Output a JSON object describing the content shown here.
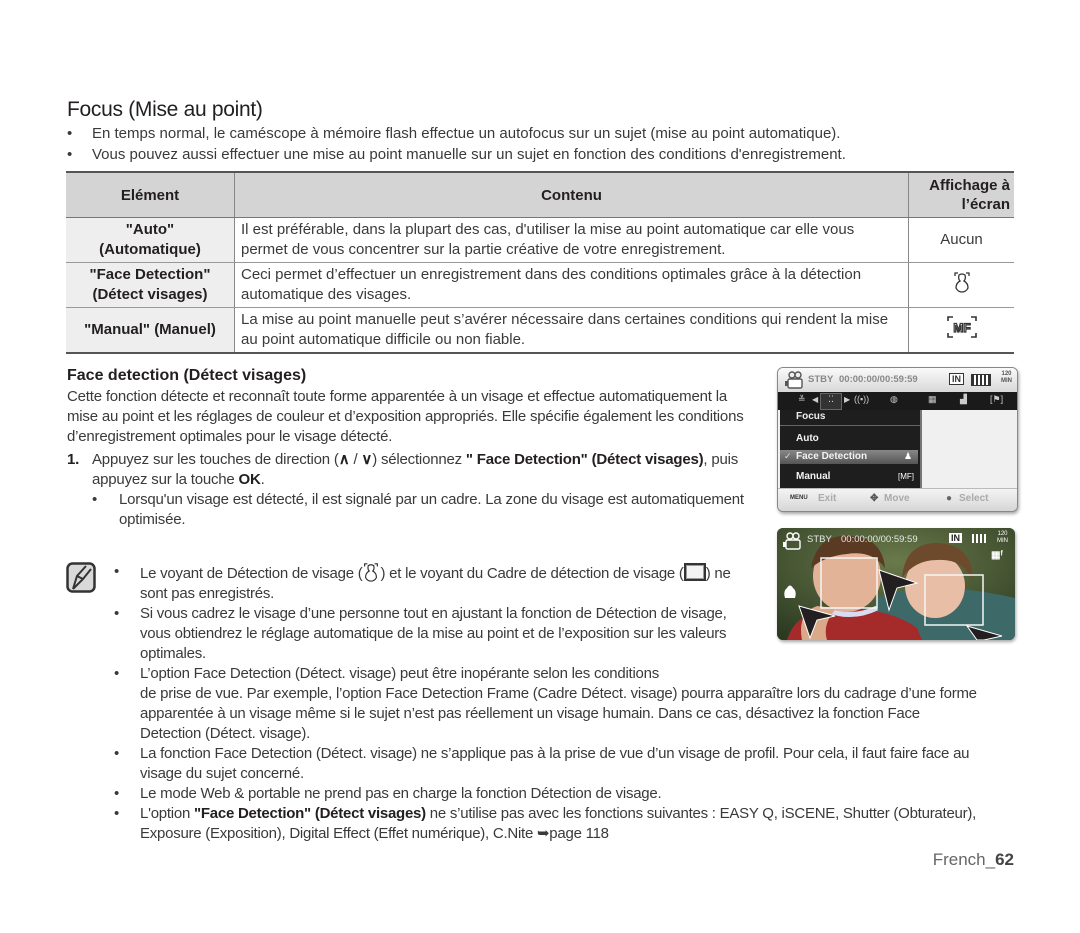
{
  "page": {
    "title": "Focus (Mise au point)",
    "intro_bullets": [
      "En temps normal, le caméscope à mémoire flash effectue un autofocus sur un sujet (mise au point automatique).",
      "Vous pouvez aussi effectuer une mise au point manuelle sur un sujet en fonction des conditions d'enregistrement."
    ],
    "bullet_char": "•"
  },
  "table": {
    "headers": [
      "Elément",
      "Contenu",
      "Affichage à",
      "l’écran"
    ],
    "rows": [
      {
        "element_line1": "\"Auto\"",
        "element_line2": "(Automatique)",
        "content": "Il est préférable, dans la plupart des cas, d'utiliser la mise au point automatique car elle vous permet de vous concentrer sur la partie créative de votre enregistrement.",
        "display": "Aucun",
        "display_icon": ""
      },
      {
        "element_line1": "\"Face Detection\"",
        "element_line2": "(Détect visages)",
        "content": "Ceci permet d’effectuer un enregistrement dans des conditions optimales grâce à la détection automatique des visages.",
        "display": "",
        "display_icon": "face-detection-icon"
      },
      {
        "element_line1": "\"Manual\" (Manuel)",
        "element_line2": "",
        "content": "La mise au point manuelle peut s’avérer nécessaire dans certaines conditions qui rendent la mise au point automatique difficile ou non fiable.",
        "display": "",
        "display_icon": "manual-focus-icon"
      }
    ]
  },
  "face_section": {
    "heading": "Face detection (Détect visages)",
    "description": "Cette fonction détecte et reconnaît toute forme apparentée à un visage et effectue automatiquement la mise au point et les réglages de couleur et d’exposition appropriés. Elle spécifie également les conditions d’enregistrement optimales pour le visage détecté.",
    "step": {
      "number": "1.",
      "text_a": "Appuyez sur les touches de direction (",
      "up_glyph": "∧",
      "slash": " / ",
      "down_glyph": "∨",
      "text_b": ") sélectionnez ",
      "bold_a": "\" Face Detection\" (Détect visages)",
      "text_c": ", puis appuyez sur la touche ",
      "bold_b": "OK",
      "text_d": "."
    },
    "sub_bullet": "Lorsqu'un visage est détecté, il est signalé par un cadre. La zone du visage est automatiquement optimisée."
  },
  "notes": {
    "icon": "note-pencil-icon",
    "items": [
      {
        "a": "Le voyant de Détection de visage (",
        "b": ") et le voyant du Cadre de détection de visage (",
        "c": ") ne sont pas enregistrés."
      },
      {
        "text": "Si vous cadrez le visage d’une personne tout en ajustant la fonction de Détection de visage, vous obtiendrez le réglage automatique de la mise au point et de l’exposition sur les valeurs optimales."
      },
      {
        "line1": "L’option Face Detection (Détect. visage) peut être inopérante selon les conditions",
        "rest": "de prise de vue. Par exemple, l’option Face Detection Frame (Cadre Détect. visage) pourra apparaître lors du cadrage d’une forme apparentée à un visage même si le sujet n’est pas réellement un visage humain. Dans ce cas, désactivez la fonction Face Detection (Détect. visage)."
      },
      {
        "text": "La fonction Face Detection (Détect. visage) ne s’applique pas à la prise de vue d’un visage de profil. Pour cela, il faut faire face au visage du sujet concerné."
      },
      {
        "text": "Le mode Web & portable ne prend pas en charge la fonction Détection de visage."
      },
      {
        "a": "L'option ",
        "bold": "\"Face Detection\" (Détect visages)",
        "b": " ne s’utilise pas avec les fonctions suivantes : EASY Q, iSCENE, Shutter (Obturateur), Exposure (Exposition), Digital Effect (Effet numérique), C.Nite ",
        "arrow": "➥",
        "c": "page 118"
      }
    ]
  },
  "camera_menu_screen": {
    "status_mode": "STBY",
    "timecode": "00:00:00/00:59:59",
    "storage_badge": "IN",
    "remaining": "120 MIN",
    "menu_title": "Focus",
    "items": [
      "Auto",
      "Face Detection",
      "Manual"
    ],
    "selected_index": 1,
    "footer": {
      "menu_key": "MENU",
      "exit": "Exit",
      "move": "Move",
      "select": "Select"
    }
  },
  "camera_live_screen": {
    "status_mode": "STBY",
    "timecode": "00:00:00/00:59:59",
    "storage_badge": "IN",
    "remaining_num": "120",
    "remaining_unit": "MIN",
    "focus_indicator": "MF face icon"
  },
  "footer": {
    "lang": "French_",
    "page": "62"
  }
}
